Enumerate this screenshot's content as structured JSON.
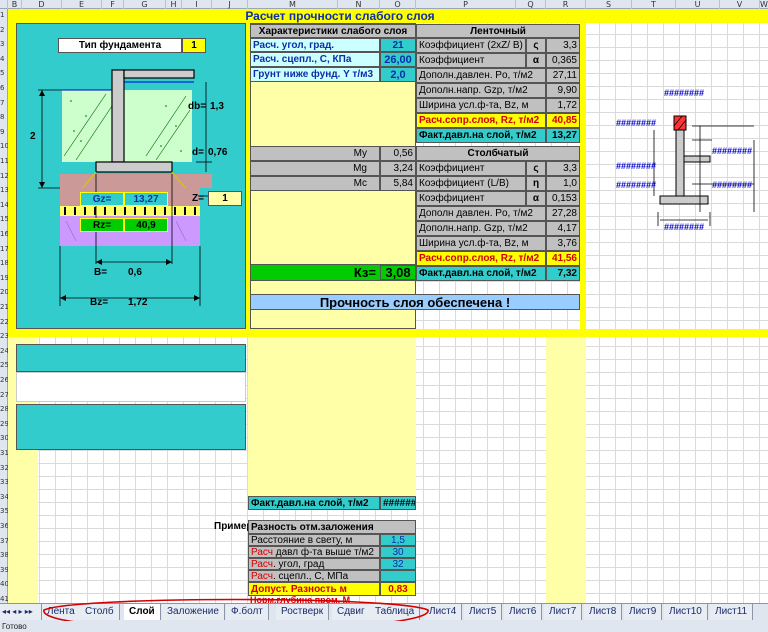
{
  "columns": [
    "B",
    "D",
    "E",
    "F",
    "G",
    "H",
    "I",
    "J",
    "M",
    "N",
    "O",
    "P",
    "Q",
    "R",
    "S",
    "T",
    "U",
    "V",
    "W"
  ],
  "rows": [
    "1",
    "2",
    "3",
    "4",
    "5",
    "6",
    "7",
    "8",
    "9",
    "10",
    "11",
    "12",
    "13",
    "14",
    "15",
    "16",
    "17",
    "18",
    "19",
    "20",
    "21",
    "22",
    "23",
    "24",
    "25",
    "26",
    "27",
    "28",
    "29",
    "30",
    "31",
    "32",
    "33",
    "34",
    "35",
    "36",
    "37",
    "38",
    "39",
    "40",
    "41"
  ],
  "title": "Расчет прочности слабого слоя",
  "foundation": {
    "type_label": "Тип фундамента",
    "type_value": "1",
    "dim_2": "2",
    "db_label": "db=",
    "db_value": "1,3",
    "d_label": "d=",
    "d_value": "0,76",
    "z_label": "Z=",
    "z_value": "1",
    "gz_label": "Gz=",
    "gz_value": "13,27",
    "rz_label": "Rz=",
    "rz_value": "40,9",
    "b_label": "B=",
    "b_value": "0,6",
    "bz_label": "Bz=",
    "bz_value": "1,72"
  },
  "weak_layer": {
    "header": "Характеристики слабого слоя",
    "rows": [
      {
        "label": "Расч. угол,        град.",
        "value": "21"
      },
      {
        "label": "Расч. сцепл.,  С,    КПа",
        "value": "26,00"
      },
      {
        "label": "Грунт ниже фунд. Y  т/м3",
        "value": "2,0"
      }
    ],
    "coefs": [
      {
        "label": "My",
        "value": "0,56"
      },
      {
        "label": "Mg",
        "value": "3,24"
      },
      {
        "label": "Mc",
        "value": "5,84"
      }
    ],
    "kz_label": "Кз=",
    "kz_value": "3,08",
    "verdict": "Прочность слоя обеспечена !"
  },
  "strip": {
    "header": "Ленточный",
    "rows": [
      {
        "label": "Коэффициент (2xZ/ B)",
        "sym": "ς",
        "value": "3,3"
      },
      {
        "label": "Коэффициент",
        "sym": "α",
        "value": "0,365"
      },
      {
        "label": "Дополн.давлен.   Po, т/м2",
        "sym": "",
        "value": "27,11"
      },
      {
        "label": "Дополн.напр.     Gzp, т/м2",
        "sym": "",
        "value": "9,90"
      },
      {
        "label": "Ширина усл.ф-та,    Bz, м",
        "sym": "",
        "value": "1,72"
      }
    ],
    "calc_label": "Расч.сопр.слоя, Rz, т/м2",
    "calc_value": "40,85",
    "fact_label": "Факт.давл.на слой, т/м2",
    "fact_value": "13,27"
  },
  "column": {
    "header": "Столбчатый",
    "rows": [
      {
        "label": "Коэффициент",
        "sym": "ς",
        "value": "3,3"
      },
      {
        "label": "Коэффициент (L/B)",
        "sym": "η",
        "value": "1,0"
      },
      {
        "label": "Коэффициент",
        "sym": "α",
        "value": "0,153"
      },
      {
        "label": "Дополн давлен.   Po, т/м2",
        "sym": "",
        "value": "27,28"
      },
      {
        "label": "Дополн.напр.     Gzp, т/м2",
        "sym": "",
        "value": "4,17"
      },
      {
        "label": "Ширина усл.ф-та,    Bz, м",
        "sym": "",
        "value": "3,76"
      }
    ],
    "calc_label": "Расч.сопр.слоя, Rz, т/м2",
    "calc_value": "41,56",
    "fact_label": "Факт.давл.на слой, т/м2",
    "fact_value": "7,32"
  },
  "right_diagram": {
    "hash": "########"
  },
  "lower": {
    "fact_label": "Факт.давл.на слой,  т/м2",
    "fact_value": "######",
    "primer": "Пример",
    "diff_header": "Разность отм.заложения",
    "rows": [
      {
        "label_red": "",
        "label": "Расстояние в свету,      м",
        "value": "1,5"
      },
      {
        "label_red": "Расч",
        "label": " давл ф-та выше  т/м2",
        "value": "30"
      },
      {
        "label_red": "Расч",
        "label": ". угол,           град",
        "value": "32"
      },
      {
        "label_red": "Расч",
        "label": ". сцепл.,  С,      МПа",
        "value": ""
      }
    ],
    "allow_label": "Допуст. Разность    м",
    "allow_value": "0,83",
    "norm_label": "Норм.глубина пром.  М"
  },
  "tabs": [
    "Лента",
    "Столб",
    "Слой",
    "Заложение",
    "Ф.болт",
    "Ростверк",
    "Сдвиг",
    "Таблица",
    "Лист4",
    "Лист5",
    "Лист6",
    "Лист7",
    "Лист8",
    "Лист9",
    "Лист10",
    "Лист11"
  ],
  "active_tab": "Слой",
  "status": "Готово",
  "colors": {
    "cyan": "#33cccc",
    "yellow": "#ffff00",
    "green": "#00cc00",
    "soil_green": "#ccffcc",
    "soil_brown": "#cc9999",
    "soil_purple": "#cc99ff",
    "red_annotation": "#d40000"
  }
}
